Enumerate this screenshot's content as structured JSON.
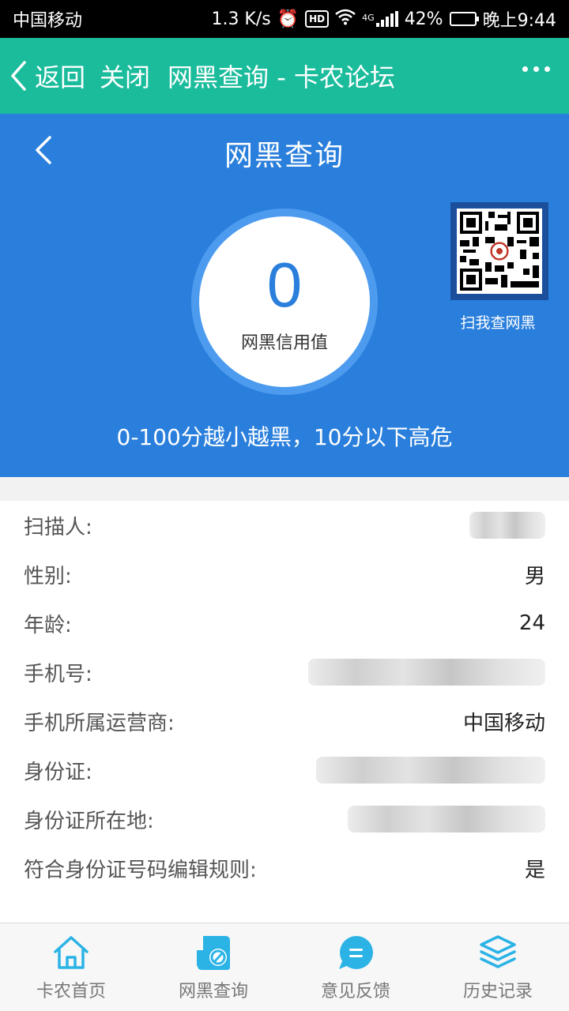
{
  "status_bar": {
    "carrier": "中国移动",
    "speed": "1.3 K/s",
    "hd": "HD",
    "network": "4G",
    "battery": "42%",
    "battery_level": 0.42,
    "time": "晚上9:44"
  },
  "top_nav": {
    "back_label": "返回",
    "close_label": "关闭",
    "title": "网黑查询 - 卡农论坛"
  },
  "hero": {
    "title": "网黑查询",
    "score_value": "0",
    "score_label": "网黑信用值",
    "qr_caption": "扫我查网黑",
    "note": "0-100分越小越黑，10分以下高危"
  },
  "info": {
    "rows": [
      {
        "label": "扫描人:",
        "value": ""
      },
      {
        "label": "性别:",
        "value": "男"
      },
      {
        "label": "年龄:",
        "value": "24"
      },
      {
        "label": "手机号:",
        "value": ""
      },
      {
        "label": "手机所属运营商:",
        "value": "中国移动"
      },
      {
        "label": "身份证:",
        "value": ""
      },
      {
        "label": "身份证所在地:",
        "value": ""
      },
      {
        "label": "符合身份证号码编辑规则:",
        "value": "是"
      }
    ]
  },
  "tabbar": {
    "items": [
      {
        "label": "卡农首页",
        "icon": "home-icon"
      },
      {
        "label": "网黑查询",
        "icon": "blacklist-query-icon"
      },
      {
        "label": "意见反馈",
        "icon": "feedback-icon"
      },
      {
        "label": "历史记录",
        "icon": "history-layers-icon"
      }
    ]
  },
  "colors": {
    "nav_green": "#1abc9c",
    "hero_blue": "#2a7fdc",
    "tab_icon": "#2bb3e6"
  }
}
